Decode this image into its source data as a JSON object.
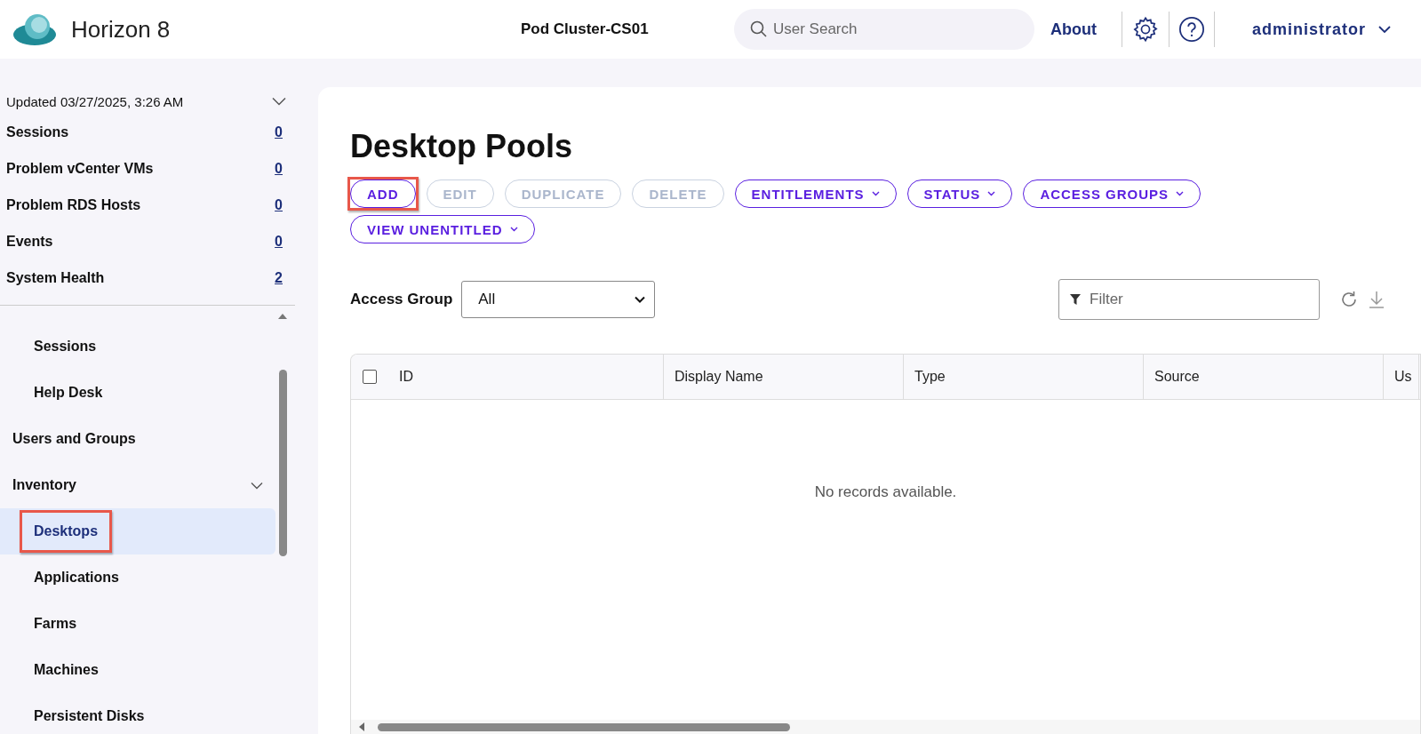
{
  "header": {
    "product": "Horizon 8",
    "pod": "Pod Cluster-CS01",
    "search": {
      "placeholder": "User Search"
    },
    "about": "About",
    "user": "administrator"
  },
  "summary": {
    "updated": "Updated 03/27/2025, 3:26 AM",
    "rows": [
      {
        "label": "Sessions",
        "count": "0"
      },
      {
        "label": "Problem vCenter VMs",
        "count": "0"
      },
      {
        "label": "Problem RDS Hosts",
        "count": "0"
      },
      {
        "label": "Events",
        "count": "0"
      },
      {
        "label": "System Health",
        "count": "2"
      }
    ]
  },
  "nav": {
    "items": [
      {
        "children": [
          {
            "label": "Sessions",
            "selected": false,
            "highlighted": false
          },
          {
            "label": "Help Desk",
            "selected": false,
            "highlighted": false
          }
        ]
      },
      {
        "label": "Users and Groups"
      },
      {
        "label": "Inventory",
        "expanded": true,
        "children": [
          {
            "label": "Desktops",
            "selected": true,
            "highlighted": true
          },
          {
            "label": "Applications",
            "selected": false,
            "highlighted": false
          },
          {
            "label": "Farms",
            "selected": false,
            "highlighted": false
          },
          {
            "label": "Machines",
            "selected": false,
            "highlighted": false
          },
          {
            "label": "Persistent Disks",
            "selected": false,
            "highlighted": false
          }
        ]
      }
    ]
  },
  "page": {
    "title": "Desktop Pools",
    "buttons": [
      {
        "label": "ADD",
        "disabled": false,
        "dropdown": false,
        "highlighted": true
      },
      {
        "label": "EDIT",
        "disabled": true,
        "dropdown": false,
        "highlighted": false
      },
      {
        "label": "DUPLICATE",
        "disabled": true,
        "dropdown": false,
        "highlighted": false
      },
      {
        "label": "DELETE",
        "disabled": true,
        "dropdown": false,
        "highlighted": false
      },
      {
        "label": "ENTITLEMENTS",
        "disabled": false,
        "dropdown": true,
        "highlighted": false
      },
      {
        "label": "STATUS",
        "disabled": false,
        "dropdown": true,
        "highlighted": false
      },
      {
        "label": "ACCESS GROUPS",
        "disabled": false,
        "dropdown": true,
        "highlighted": false
      },
      {
        "label": "VIEW UNENTITLED",
        "disabled": false,
        "dropdown": true,
        "highlighted": false
      }
    ],
    "access_group": {
      "label": "Access Group",
      "value": "All"
    },
    "filter": {
      "placeholder": "Filter"
    },
    "table": {
      "select_all_checked": false,
      "columns": [
        "ID",
        "Display Name",
        "Type",
        "Source",
        "Us"
      ],
      "empty_message": "No records available."
    }
  }
}
